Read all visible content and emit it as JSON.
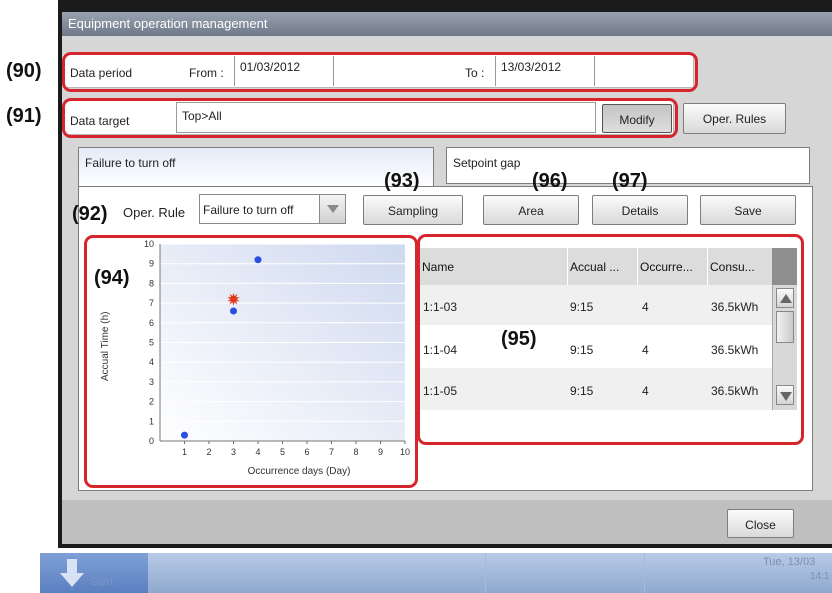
{
  "window": {
    "title": "Equipment operation management"
  },
  "data_period": {
    "label": "Data period",
    "from_label": "From :",
    "from_value": "01/03/2012",
    "to_label": "To :",
    "to_value": "13/03/2012"
  },
  "data_target": {
    "label": "Data target",
    "value": "Top>All",
    "modify": "Modify",
    "oper_rules": "Oper. Rules"
  },
  "tabs": [
    "Failure to turn off",
    "Setpoint gap"
  ],
  "toolbar": {
    "oper_rule_label": "Oper. Rule",
    "oper_rule_value": "Failure to turn off",
    "sampling": "Sampling",
    "area": "Area",
    "details": "Details",
    "save": "Save"
  },
  "callouts": {
    "c90": "(90)",
    "c91": "(91)",
    "c92": "(92)",
    "c93": "(93)",
    "c94": "(94)",
    "c95": "(95)",
    "c96": "(96)",
    "c97": "(97)"
  },
  "table": {
    "columns": [
      "Name",
      "Accual ...",
      "Occurre...",
      "Consu..."
    ],
    "rows": [
      [
        "1:1-03",
        "9:15",
        "4",
        "36.5kWh"
      ],
      [
        "1:1-04",
        "9:15",
        "4",
        "36.5kWh"
      ],
      [
        "1:1-05",
        "9:15",
        "4",
        "36.5kWh"
      ]
    ]
  },
  "footer": {
    "close": "Close"
  },
  "taskbar": {
    "start": "Start",
    "date": "Tue, 13/03",
    "time": "14:1"
  },
  "chart_data": {
    "type": "scatter",
    "xlabel": "Occurrence days (Day)",
    "ylabel": "Accual Time (h)",
    "xlim": [
      0,
      10
    ],
    "ylim": [
      0,
      10
    ],
    "x_ticks": [
      1,
      2,
      3,
      4,
      5,
      6,
      7,
      8,
      9,
      10
    ],
    "y_ticks": [
      0,
      1,
      2,
      3,
      4,
      5,
      6,
      7,
      8,
      9,
      10
    ],
    "grid": true,
    "points": [
      {
        "x": 1,
        "y": 0.3,
        "color": "#2b4fe0",
        "marker": "dot"
      },
      {
        "x": 3,
        "y": 6.6,
        "color": "#2b4fe0",
        "marker": "dot"
      },
      {
        "x": 4,
        "y": 9.2,
        "color": "#2b4fe0",
        "marker": "dot"
      },
      {
        "x": 3,
        "y": 7.2,
        "color": "#e03a1e",
        "marker": "star"
      }
    ]
  }
}
